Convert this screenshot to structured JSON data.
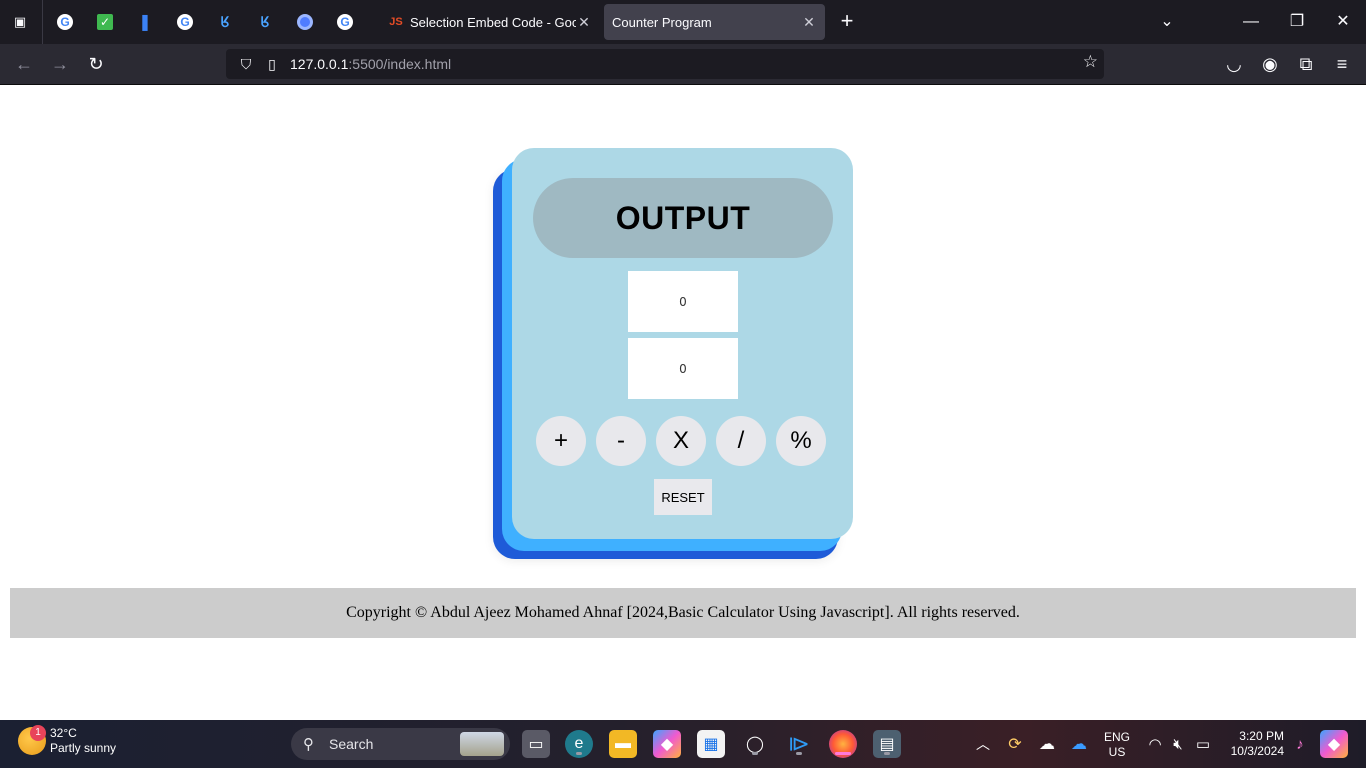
{
  "browser": {
    "tabs": [
      {
        "title": "Selection Embed Code - Google",
        "favicon": "js-favicon-icon"
      },
      {
        "title": "Counter Program",
        "favicon": "none"
      }
    ],
    "pinned_icons": [
      "google-icon",
      "check-icon",
      "bookmark-icon",
      "google-icon",
      "edu-icon",
      "edu-icon",
      "target-icon",
      "google-icon"
    ],
    "url_host": "127.0.0.1",
    "url_path": ":5500/index.html"
  },
  "calculator": {
    "output_label": "OUTPUT",
    "input1_value": "0",
    "input2_value": "0",
    "operators": [
      "+",
      "-",
      "X",
      "/",
      "%"
    ],
    "reset_label": "RESET",
    "colors": {
      "panel": "#add8e6",
      "output": "#9fb9c2",
      "layer_mid": "#3fb0ff",
      "layer_back": "#1e5bd8"
    }
  },
  "footer": {
    "text": "Copyright © Abdul Ajeez Mohamed Ahnaf [2024,Basic Calculator Using Javascript]. All rights reserved."
  },
  "taskbar": {
    "weather_temp": "32°C",
    "weather_desc": "Partly sunny",
    "weather_badge": "1",
    "search_label": "Search",
    "lang_1": "ENG",
    "lang_2": "US",
    "time": "3:20 PM",
    "date": "10/3/2024"
  }
}
